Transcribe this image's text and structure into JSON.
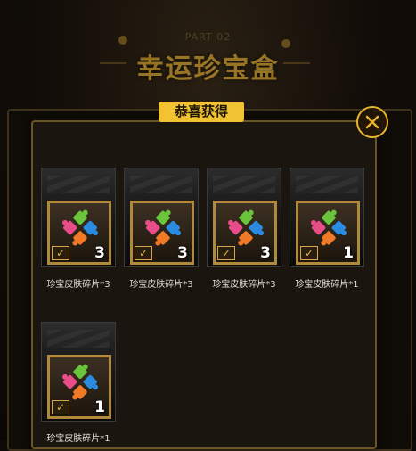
{
  "header": {
    "subtitle": "PART 02",
    "title": "幸运珍宝盒"
  },
  "modal": {
    "title": "恭喜获得",
    "close_icon": "close-icon"
  },
  "items": [
    {
      "name": "珍宝皮肤碎片*3",
      "count": "3"
    },
    {
      "name": "珍宝皮肤碎片*3",
      "count": "3"
    },
    {
      "name": "珍宝皮肤碎片*3",
      "count": "3"
    },
    {
      "name": "珍宝皮肤碎片*1",
      "count": "1"
    },
    {
      "name": "珍宝皮肤碎片*1",
      "count": "1"
    }
  ],
  "colors": {
    "accent": "#f1c232",
    "frame": "#b08a3a",
    "puzzle_green": "#6ac43c",
    "puzzle_pink": "#e84d8a",
    "puzzle_blue": "#2b8be0",
    "puzzle_orange": "#f07a28"
  }
}
